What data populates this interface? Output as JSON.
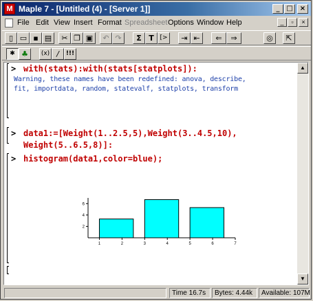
{
  "window": {
    "title": "Maple 7 - [Untitled (4) - [Server 1]]",
    "controls": {
      "minimize": "_",
      "maximize": "□",
      "close": "×"
    }
  },
  "menu": {
    "items": [
      "File",
      "Edit",
      "View",
      "Insert",
      "Format",
      "Spreadsheet",
      "Options",
      "Window",
      "Help"
    ],
    "doc_controls": {
      "minimize": "_",
      "restore": "▫",
      "close": "×"
    }
  },
  "toolbar": {
    "buttons": [
      {
        "name": "new-icon",
        "glyph": "▯"
      },
      {
        "name": "open-icon",
        "glyph": "▭"
      },
      {
        "name": "save-icon",
        "glyph": "▪"
      },
      {
        "name": "print-icon",
        "glyph": "▤"
      },
      {
        "name": "cut-icon",
        "glyph": "✂"
      },
      {
        "name": "copy-icon",
        "glyph": "❐"
      },
      {
        "name": "paste-icon",
        "glyph": "▣"
      },
      {
        "name": "undo-icon",
        "glyph": "↶"
      },
      {
        "name": "redo-icon",
        "glyph": "↷"
      },
      {
        "name": "sigma-icon",
        "glyph": "Σ"
      },
      {
        "name": "text-icon",
        "glyph": "T"
      },
      {
        "name": "execute-group-icon",
        "glyph": "[>"
      },
      {
        "name": "indent-icon",
        "glyph": "⇥"
      },
      {
        "name": "outdent-icon",
        "glyph": "⇤"
      },
      {
        "name": "back-icon",
        "glyph": "⇐"
      },
      {
        "name": "forward-icon",
        "glyph": "⇒"
      },
      {
        "name": "stop-icon",
        "glyph": "◎"
      },
      {
        "name": "help-icon",
        "glyph": "⇱"
      }
    ]
  },
  "toolbar2": {
    "buttons": [
      {
        "name": "expression-icon",
        "glyph": "✱"
      },
      {
        "name": "maple-leaf-icon",
        "glyph": "♣"
      },
      {
        "name": "fraction-icon",
        "glyph": "(x)"
      },
      {
        "name": "italic-icon",
        "glyph": "/"
      },
      {
        "name": "exclaim-icon",
        "glyph": "!!!"
      }
    ]
  },
  "worksheet": {
    "prompt": ">",
    "cmd1": "with(stats):with(stats[statplots]):",
    "warn1": "Warning, these names have been redefined: anova, describe,",
    "warn2": "fit, importdata, random, statevalf, statplots, transform",
    "cmd2a": "data1:=[Weight(1..2.5,5),Weight(3..4.5,10),",
    "cmd2b": "Weight(5..6.5,8)]:",
    "cmd3": "histogram(data1,color=blue);"
  },
  "chart_data": {
    "type": "bar",
    "bars": [
      {
        "x0": 1,
        "x1": 2.5,
        "height": 3.3
      },
      {
        "x0": 3,
        "x1": 4.5,
        "height": 6.7
      },
      {
        "x0": 5,
        "x1": 6.5,
        "height": 5.3
      }
    ],
    "fill_color": "#00ffff",
    "xlim": [
      0.5,
      7
    ],
    "ylim": [
      0,
      7
    ],
    "xticks": [
      "1",
      "2",
      "3",
      "4",
      "5",
      "6",
      "7"
    ],
    "yticks": [
      "2",
      "4",
      "6"
    ],
    "ytick_values": [
      2,
      4,
      6
    ]
  },
  "statusbar": {
    "time": "Time 16.7s",
    "bytes": "Bytes: 4.44k",
    "available": "Available: 107M"
  }
}
